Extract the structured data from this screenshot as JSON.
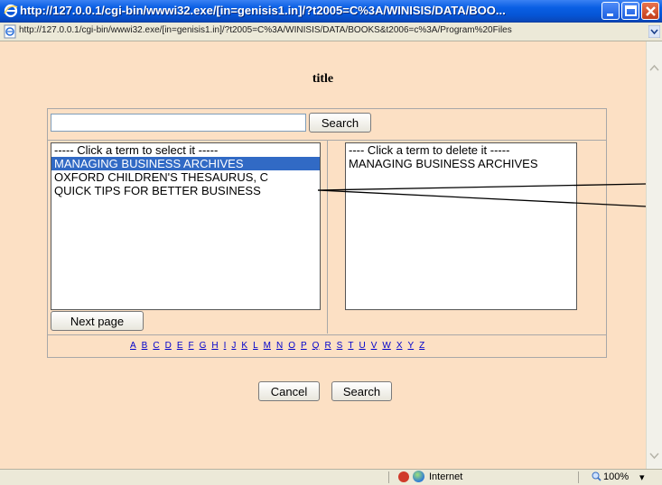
{
  "window": {
    "title": "http://127.0.0.1/cgi-bin/wwwi32.exe/[in=genisis1.in]/?t2005=C%3A/WINISIS/DATA/BOO..."
  },
  "address_bar": {
    "url": "http://127.0.0.1/cgi-bin/wwwi32.exe/[in=genisis1.in]/?t2005=C%3A/WINISIS/DATA/BOOKS&t2006=c%3A/Program%20Files"
  },
  "page": {
    "title": "title",
    "search_value": "",
    "search_button": "Search",
    "left_list": {
      "header": "----- Click a term to select it -----",
      "items": [
        "MANAGING BUSINESS ARCHIVES",
        "OXFORD CHILDREN'S THESAURUS, C",
        "QUICK TIPS FOR BETTER BUSINESS"
      ],
      "selected_index": 0
    },
    "right_list": {
      "header": "---- Click a term to delete it -----",
      "items": [
        "MANAGING BUSINESS ARCHIVES"
      ]
    },
    "next_page_button": "Next page",
    "letters": [
      "A",
      "B",
      "C",
      "D",
      "E",
      "F",
      "G",
      "H",
      "I",
      "J",
      "K",
      "L",
      "M",
      "N",
      "O",
      "P",
      "Q",
      "R",
      "S",
      "T",
      "U",
      "V",
      "W",
      "X",
      "Y",
      "Z"
    ],
    "cancel_button": "Cancel",
    "bottom_search_button": "Search"
  },
  "status_bar": {
    "zone": "Internet",
    "zoom": "100%"
  },
  "icons": {
    "title": "ie-icon",
    "address": "page-icon",
    "minimize": "minimize-icon",
    "maximize": "maximize-icon",
    "close": "close-icon",
    "zone": "globe-icon"
  },
  "colors": {
    "page_background": "#fce0c4",
    "selection": "#316ac5",
    "link": "#0000cc",
    "titlebar": "#0555d6"
  }
}
